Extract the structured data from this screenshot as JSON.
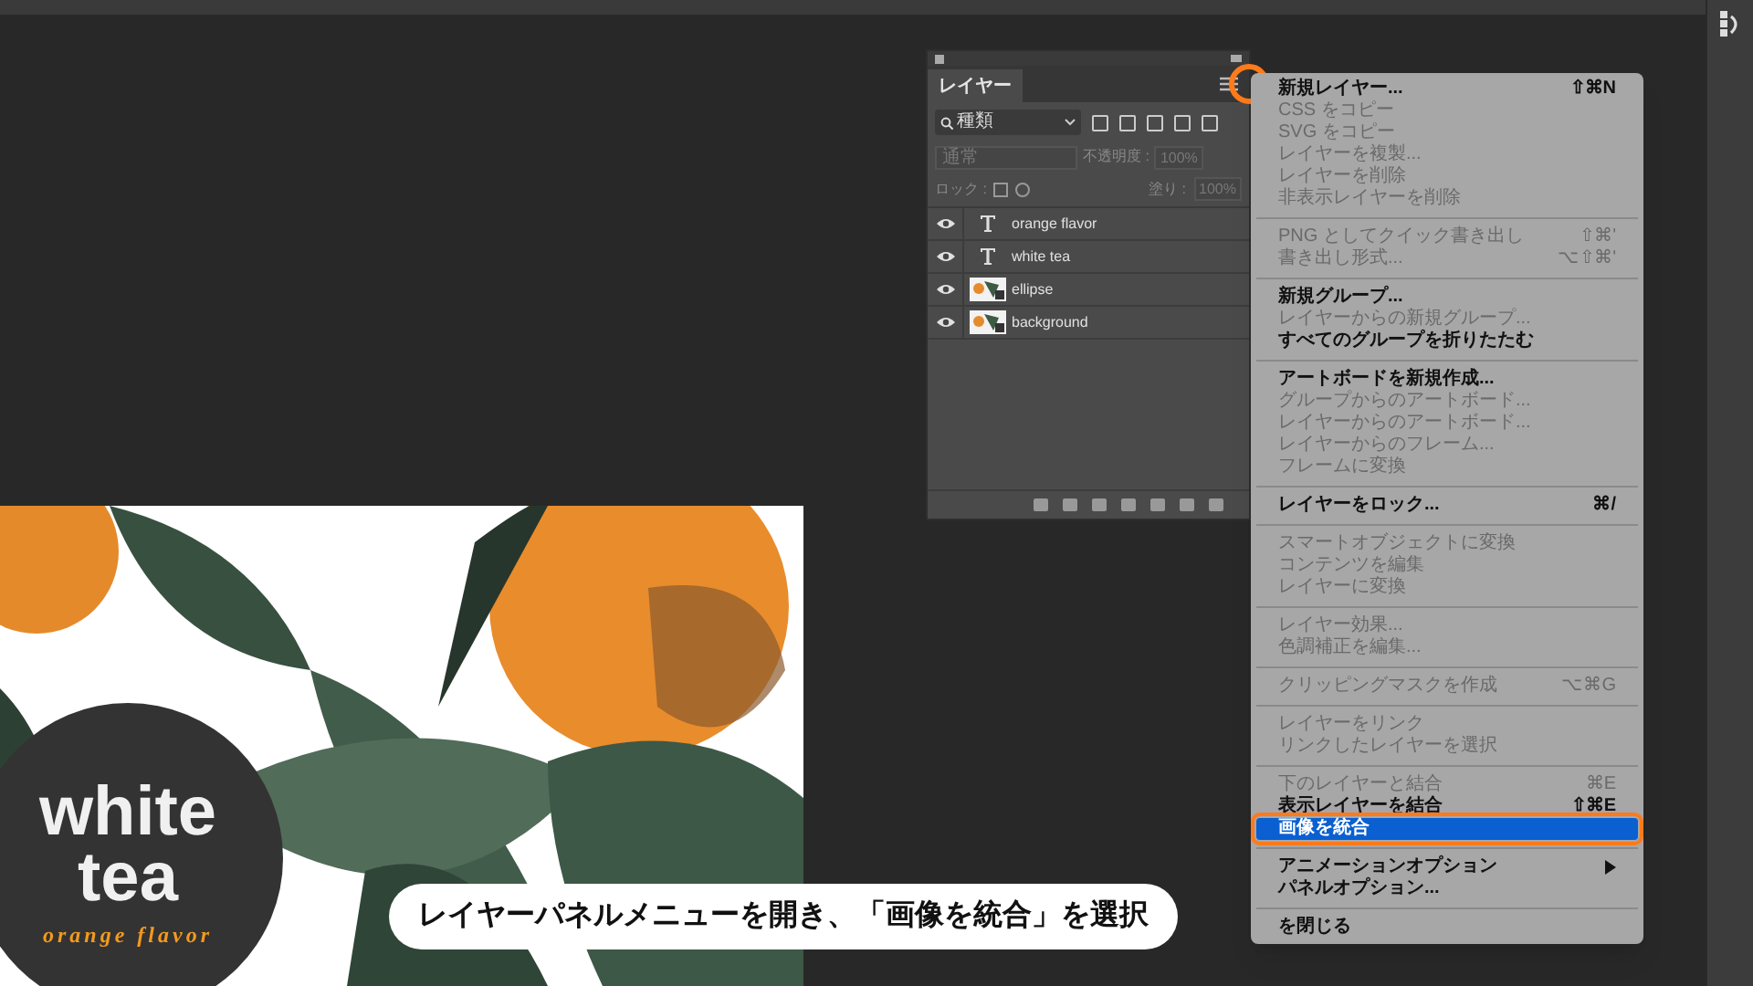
{
  "layers_panel": {
    "tab": "レイヤー",
    "filter": "種類",
    "blend_mode": "通常",
    "opacity_label": "不透明度 :",
    "opacity": "100%",
    "lock_label": "ロック :",
    "fill_label": "塗り :",
    "fill": "100%",
    "layers": [
      {
        "kind": "text",
        "name": "orange flavor",
        "visible": true
      },
      {
        "kind": "text",
        "name": "white tea",
        "visible": true
      },
      {
        "kind": "image",
        "name": "ellipse",
        "visible": true
      },
      {
        "kind": "image",
        "name": "background",
        "visible": true
      }
    ]
  },
  "menu": {
    "groups": [
      [
        {
          "label": "新規レイヤー...",
          "shortcut": "⇧⌘N",
          "disabled": false,
          "selected": false
        },
        {
          "label": "CSS をコピー",
          "disabled": true,
          "selected": false
        },
        {
          "label": "SVG をコピー",
          "disabled": true,
          "selected": false
        },
        {
          "label": "レイヤーを複製...",
          "disabled": true,
          "selected": false
        },
        {
          "label": "レイヤーを削除",
          "disabled": true,
          "selected": false
        },
        {
          "label": "非表示レイヤーを削除",
          "disabled": true,
          "selected": false
        }
      ],
      [
        {
          "label": "PNG としてクイック書き出し",
          "shortcut": "⇧⌘'",
          "disabled": true,
          "selected": false
        },
        {
          "label": "書き出し形式...",
          "shortcut": "⌥⇧⌘'",
          "disabled": true,
          "selected": false
        }
      ],
      [
        {
          "label": "新規グループ...",
          "disabled": false,
          "selected": false
        },
        {
          "label": "レイヤーからの新規グループ...",
          "disabled": true,
          "selected": false
        },
        {
          "label": "すべてのグループを折りたたむ",
          "disabled": false,
          "selected": false
        }
      ],
      [
        {
          "label": "アートボードを新規作成...",
          "disabled": false,
          "selected": false
        },
        {
          "label": "グループからのアートボード...",
          "disabled": true,
          "selected": false
        },
        {
          "label": "レイヤーからのアートボード...",
          "disabled": true,
          "selected": false
        },
        {
          "label": "レイヤーからのフレーム...",
          "disabled": true,
          "selected": false
        },
        {
          "label": "フレームに変換",
          "disabled": true,
          "selected": false
        }
      ],
      [
        {
          "label": "レイヤーをロック...",
          "shortcut": "⌘/",
          "disabled": false,
          "selected": false
        }
      ],
      [
        {
          "label": "スマートオブジェクトに変換",
          "disabled": true,
          "selected": false
        },
        {
          "label": "コンテンツを編集",
          "disabled": true,
          "selected": false
        },
        {
          "label": "レイヤーに変換",
          "disabled": true,
          "selected": false
        }
      ],
      [
        {
          "label": "レイヤー効果...",
          "disabled": true,
          "selected": false
        },
        {
          "label": "色調補正を編集...",
          "disabled": true,
          "selected": false
        }
      ],
      [
        {
          "label": "クリッピングマスクを作成",
          "shortcut": "⌥⌘G",
          "disabled": true,
          "selected": false
        }
      ],
      [
        {
          "label": "レイヤーをリンク",
          "disabled": true,
          "selected": false
        },
        {
          "label": "リンクしたレイヤーを選択",
          "disabled": true,
          "selected": false
        }
      ],
      [
        {
          "label": "下のレイヤーと結合",
          "shortcut": "⌘E",
          "disabled": true,
          "selected": false
        },
        {
          "label": "表示レイヤーを結合",
          "shortcut": "⇧⌘E",
          "disabled": false,
          "selected": false
        },
        {
          "label": "画像を統合",
          "disabled": false,
          "selected": true
        }
      ],
      [
        {
          "label": "アニメーションオプション",
          "submenu": true,
          "disabled": false,
          "selected": false
        },
        {
          "label": "パネルオプション...",
          "disabled": false,
          "selected": false
        }
      ],
      [
        {
          "label": "を閉じる",
          "disabled": false,
          "selected": false
        }
      ]
    ]
  },
  "artwork": {
    "title_line_1": "white",
    "title_line_2": "tea",
    "subtitle": "orange flavor"
  },
  "caption": "レイヤーパネルメニューを開き、「画像を統合」を選択"
}
